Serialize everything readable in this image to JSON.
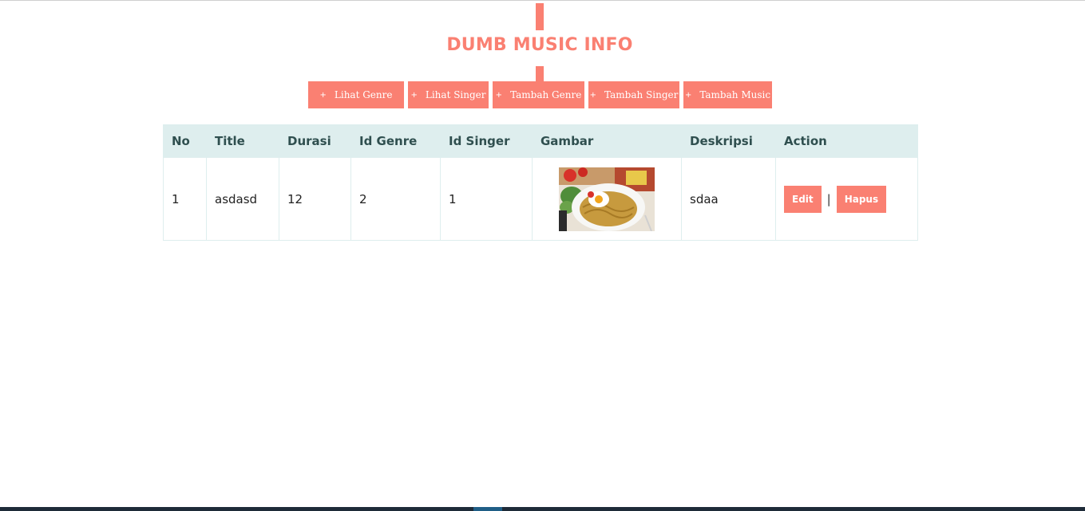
{
  "header": {
    "title": "DUMB MUSIC INFO"
  },
  "nav": {
    "items": [
      {
        "icon": "plus-icon",
        "plus": "+",
        "label": "Lihat Genre"
      },
      {
        "icon": "plus-icon",
        "plus": "+",
        "label": "Lihat Singer"
      },
      {
        "icon": "plus-icon",
        "plus": "+",
        "label": "Tambah Genre"
      },
      {
        "icon": "plus-icon",
        "plus": "+",
        "label": "Tambah Singer"
      },
      {
        "icon": "plus-icon",
        "plus": "+",
        "label": "Tambah Music"
      }
    ]
  },
  "table": {
    "columns": [
      "No",
      "Title",
      "Durasi",
      "Id Genre",
      "Id Singer",
      "Gambar",
      "Deskripsi",
      "Action"
    ],
    "rows": [
      {
        "no": "1",
        "title": "asdasd",
        "durasi": "12",
        "id_genre": "2",
        "id_singer": "1",
        "gambar": "food-photo",
        "deskripsi": "sdaa",
        "actions": {
          "edit": "Edit",
          "separator": "|",
          "delete": "Hapus"
        }
      }
    ]
  },
  "colors": {
    "accent": "#fa8072",
    "header_bg": "#deeeee",
    "header_text": "#2f4f4f"
  }
}
